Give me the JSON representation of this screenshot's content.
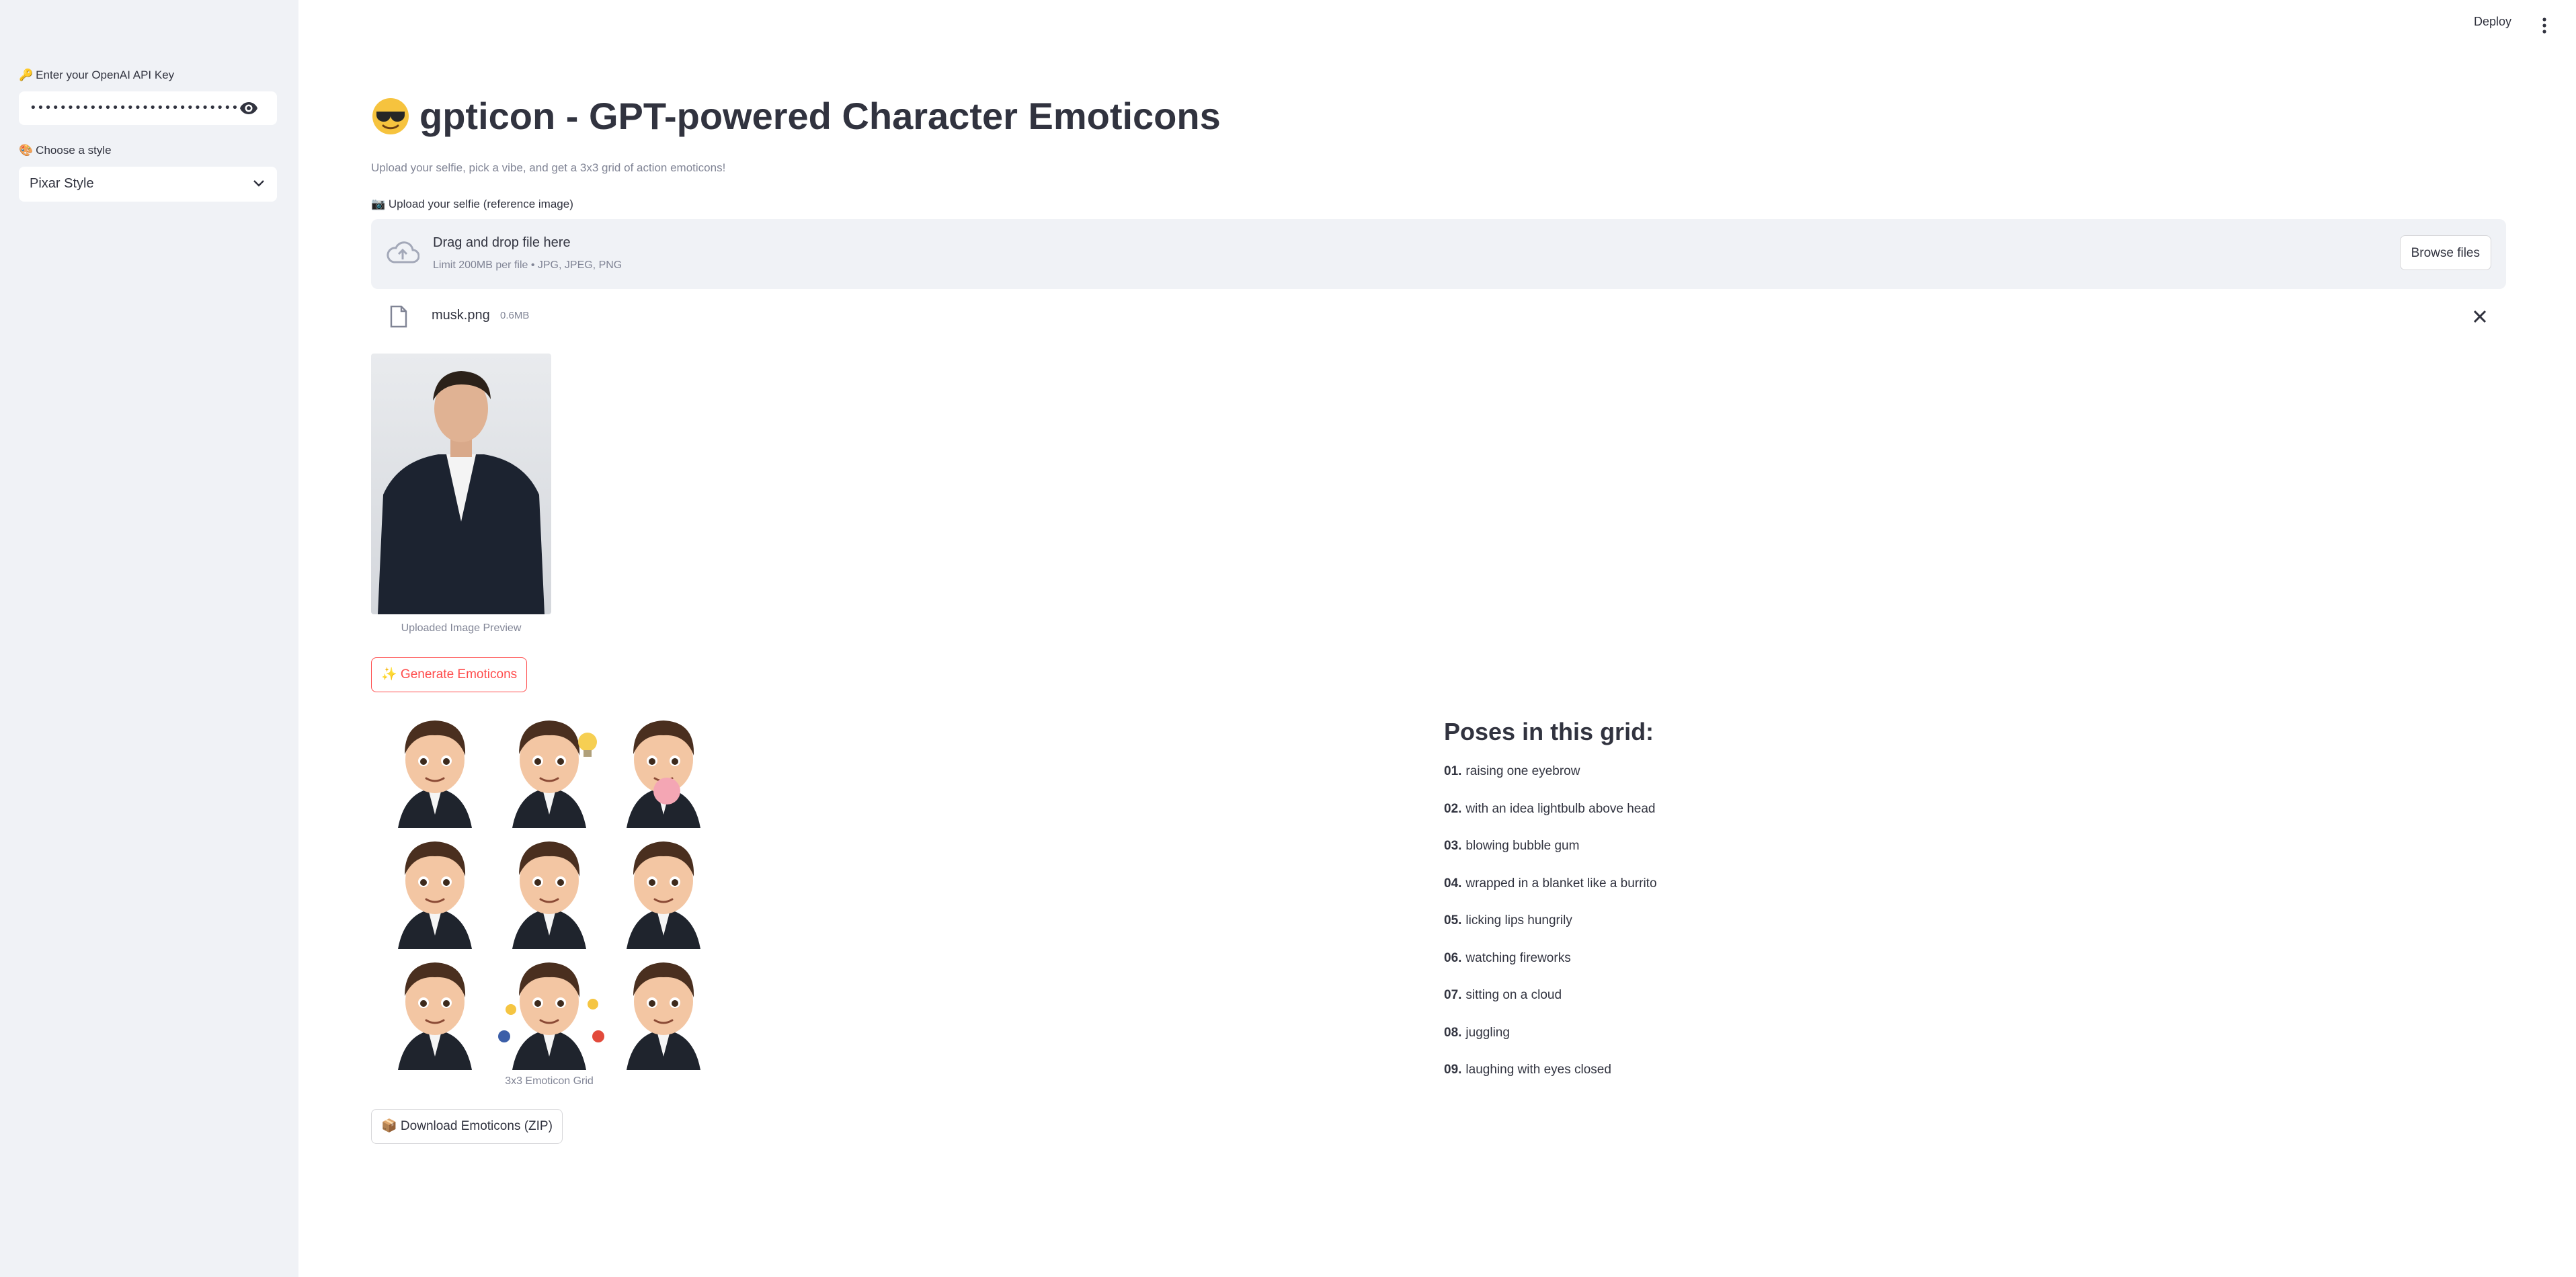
{
  "sidebar": {
    "api_key_label": "Enter your OpenAI API Key",
    "api_key_value": "••••••••••••••••••••••••••••••••••••••••••••••••••••",
    "style_label": "Choose a style",
    "style_value": "Pixar Style"
  },
  "header": {
    "deploy_label": "Deploy"
  },
  "main": {
    "title": "gpticon - GPT-powered Character Emoticons",
    "subtitle": "Upload your selfie, pick a vibe, and get a 3x3 grid of action emoticons!",
    "upload_label": "📷 Upload your selfie (reference image)",
    "dropzone_title": "Drag and drop file here",
    "dropzone_limit": "Limit 200MB per file • JPG, JPEG, PNG",
    "browse_label": "Browse files",
    "file_name": "musk.png",
    "file_size": "0.6MB",
    "preview_caption": "Uploaded Image Preview",
    "generate_label": "✨ Generate Emoticons",
    "grid_caption": "3x3 Emoticon Grid",
    "download_label": "📦 Download Emoticons (ZIP)",
    "poses_title": "Poses in this grid:",
    "poses": [
      {
        "num": "01.",
        "text": "raising one eyebrow"
      },
      {
        "num": "02.",
        "text": "with an idea lightbulb above head"
      },
      {
        "num": "03.",
        "text": "blowing bubble gum"
      },
      {
        "num": "04.",
        "text": "wrapped in a blanket like a burrito"
      },
      {
        "num": "05.",
        "text": "licking lips hungrily"
      },
      {
        "num": "06.",
        "text": "watching fireworks"
      },
      {
        "num": "07.",
        "text": "sitting on a cloud"
      },
      {
        "num": "08.",
        "text": "juggling"
      },
      {
        "num": "09.",
        "text": "laughing with eyes closed"
      }
    ]
  },
  "colors": {
    "sidebar_bg": "#f0f2f6",
    "primary": "#ff4b4b",
    "text": "#31333f",
    "muted": "#808495"
  }
}
